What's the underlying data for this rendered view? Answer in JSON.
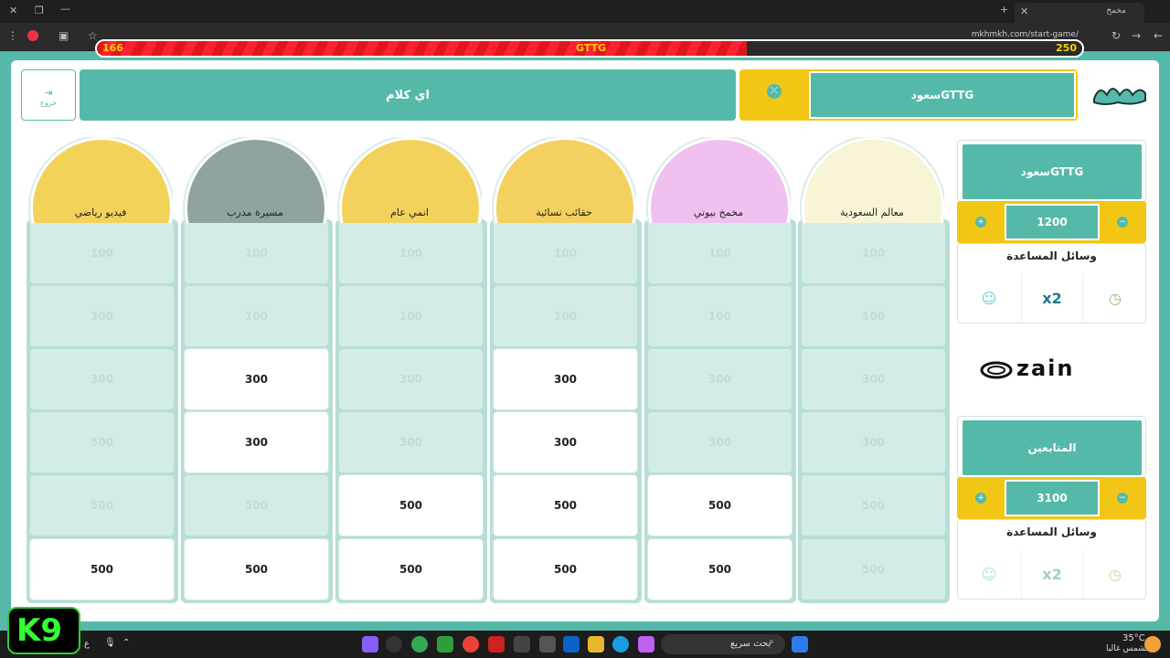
{
  "browser": {
    "tab_title": "مخمخ",
    "url": "mkhmkh.com/start-game/"
  },
  "progress": {
    "left_value": "166",
    "center_label": "GTTG",
    "right_value": "250",
    "fraction": 0.66
  },
  "header": {
    "exit_label": "خروج",
    "question_title": "اي كلام",
    "team_label": "سعودGTTG"
  },
  "categories": [
    {
      "name": "فيديو رياضي",
      "color": "#f3d25a"
    },
    {
      "name": "مسيرة مدرب",
      "color": "#8fa3a3"
    },
    {
      "name": "انمي عام",
      "color": "#f2d25a"
    },
    {
      "name": "حقائب نسائية",
      "color": "#f3d060"
    },
    {
      "name": "مخمخ بيوتي",
      "color": "#f0c0f0"
    },
    {
      "name": "معالم السعودية",
      "color": "#f8f4d6"
    }
  ],
  "board": [
    [
      [
        "100",
        "used"
      ],
      [
        "300",
        "used"
      ],
      [
        "300",
        "used"
      ],
      [
        "500",
        "used"
      ],
      [
        "500",
        "used"
      ],
      [
        "500",
        "avail"
      ]
    ],
    [
      [
        "100",
        "used"
      ],
      [
        "100",
        "used"
      ],
      [
        "300",
        "avail"
      ],
      [
        "300",
        "avail"
      ],
      [
        "500",
        "used"
      ],
      [
        "500",
        "avail"
      ]
    ],
    [
      [
        "100",
        "used"
      ],
      [
        "100",
        "used"
      ],
      [
        "300",
        "used"
      ],
      [
        "300",
        "used"
      ],
      [
        "500",
        "avail"
      ],
      [
        "500",
        "avail"
      ]
    ],
    [
      [
        "100",
        "used"
      ],
      [
        "100",
        "used"
      ],
      [
        "300",
        "avail"
      ],
      [
        "300",
        "avail"
      ],
      [
        "500",
        "avail"
      ],
      [
        "500",
        "avail"
      ]
    ],
    [
      [
        "100",
        "used"
      ],
      [
        "100",
        "used"
      ],
      [
        "300",
        "used"
      ],
      [
        "300",
        "used"
      ],
      [
        "500",
        "avail"
      ],
      [
        "500",
        "avail"
      ]
    ],
    [
      [
        "100",
        "used"
      ],
      [
        "100",
        "used"
      ],
      [
        "300",
        "used"
      ],
      [
        "300",
        "used"
      ],
      [
        "500",
        "used"
      ],
      [
        "500",
        "used"
      ]
    ]
  ],
  "team1": {
    "name": "سعودGTTG",
    "score": "1200",
    "aids_title": "وسائل المساعدة",
    "x2": "x2"
  },
  "team2": {
    "name": "المتابعين",
    "score": "3100",
    "aids_title": "وسائل المساعدة",
    "x2": "x2"
  },
  "sponsor": "zain",
  "taskbar": {
    "search": "بحث سريع",
    "weather_temp": "35°C",
    "weather_desc": "مشمس غالبا",
    "lang": "ع"
  },
  "overlay": {
    "logo": "K9"
  }
}
